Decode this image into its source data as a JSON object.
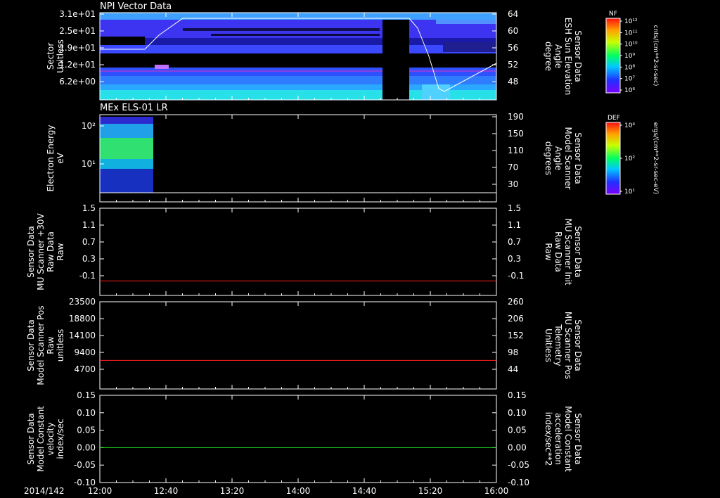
{
  "date_label": "2014/142",
  "x_tick_labels": [
    "12:00",
    "12:40",
    "13:20",
    "14:00",
    "14:40",
    "15:20",
    "16:00"
  ],
  "chart_data": [
    {
      "type": "heatmap",
      "title": "NPI Vector Data",
      "ylabel": [
        "Sector",
        "Unitless"
      ],
      "yticks": [
        "3.1e+01",
        "2.5e+01",
        "1.9e+01",
        "1.2e+01",
        "6.2e+00"
      ],
      "ylabel_right": [
        "Sensor Data",
        "ESH Sun Elevation",
        "Angle",
        "degree"
      ],
      "yticks_right": [
        "64",
        "60",
        "56",
        "52",
        "48"
      ],
      "colorbar": {
        "label": "NF",
        "unit": "cnts/(cm**2-sr-sec)",
        "ticks": [
          "10^12",
          "10^11",
          "10^10",
          "10^9",
          "10^8",
          "10^7",
          "10^6"
        ]
      },
      "overlay_line": {
        "x": [
          "12:00",
          "12:40",
          "12:45",
          "12:50",
          "14:40",
          "15:08",
          "15:18",
          "15:24",
          "15:30",
          "16:00"
        ],
        "y": [
          56,
          56,
          60,
          64,
          64,
          64,
          56,
          48,
          46,
          52
        ]
      }
    },
    {
      "type": "heatmap",
      "title": "MEx ELS-01 LR",
      "ylabel": [
        "Electron Energy",
        "eV"
      ],
      "yticks": [
        "10^2",
        "10^1"
      ],
      "ylabel_right": [
        "Sensor Data",
        "Model Scanner",
        "Angle",
        "degrees"
      ],
      "yticks_right": [
        "190",
        "150",
        "110",
        "70",
        "30"
      ],
      "colorbar": {
        "label": "DEF",
        "unit": "ergs/(cm**2-sr-sec-eV)",
        "ticks": [
          "10^4",
          "10^2",
          "10^1"
        ]
      },
      "data_window": [
        "12:00",
        "12:30"
      ],
      "overlay_line": {
        "x": [
          "12:00",
          "16:00"
        ],
        "y": [
          20,
          20
        ]
      }
    },
    {
      "type": "line",
      "ylabel": [
        "Sensor Data",
        "MU Scanner +30V",
        "Raw Data",
        "Raw"
      ],
      "ylim": [
        -0.3,
        1.5
      ],
      "yticks": [
        "1.5",
        "1.1",
        "0.7",
        "0.3",
        "-0.1"
      ],
      "ylabel_right": [
        "Sensor Data",
        "MU Scanner Init",
        "Raw Data",
        "Raw"
      ],
      "yticks_right": [
        "1.5",
        "1.1",
        "0.7",
        "0.3",
        "-0.1"
      ],
      "series": [
        {
          "color": "#ff2020",
          "x": [
            "12:00",
            "16:00"
          ],
          "y": [
            0.0,
            0.0
          ]
        }
      ]
    },
    {
      "type": "line",
      "ylabel": [
        "Sensor Data",
        "Model Scanner Pos",
        "Raw",
        "unitless"
      ],
      "ylim": [
        0,
        23500
      ],
      "yticks": [
        "23500",
        "18800",
        "14100",
        "9400",
        "4700"
      ],
      "ylabel_right": [
        "Sensor Data",
        "MU Scanner Pos",
        "Telemetry",
        "Unitless"
      ],
      "yticks_right": [
        "260",
        "206",
        "152",
        "98",
        "44"
      ],
      "series": [
        {
          "color": "#ff2020",
          "x": [
            "12:00",
            "16:00"
          ],
          "y": [
            7700,
            7700
          ]
        }
      ]
    },
    {
      "type": "line",
      "ylabel": [
        "Sensor Data",
        "Model Constant",
        "velocity",
        "index/sec"
      ],
      "ylim": [
        -0.1,
        0.15
      ],
      "yticks": [
        "0.15",
        "0.10",
        "0.05",
        "0.00",
        "-0.05",
        "-0.10"
      ],
      "ylabel_right": [
        "Sensor Data",
        "Model Constant",
        "acceleration",
        "index/sec**2"
      ],
      "yticks_right": [
        "0.15",
        "0.10",
        "0.05",
        "0.00",
        "-0.05",
        "-0.10"
      ],
      "series": [
        {
          "color": "#20e020",
          "x": [
            "12:00",
            "16:00"
          ],
          "y": [
            0.0,
            0.0
          ]
        }
      ]
    }
  ]
}
